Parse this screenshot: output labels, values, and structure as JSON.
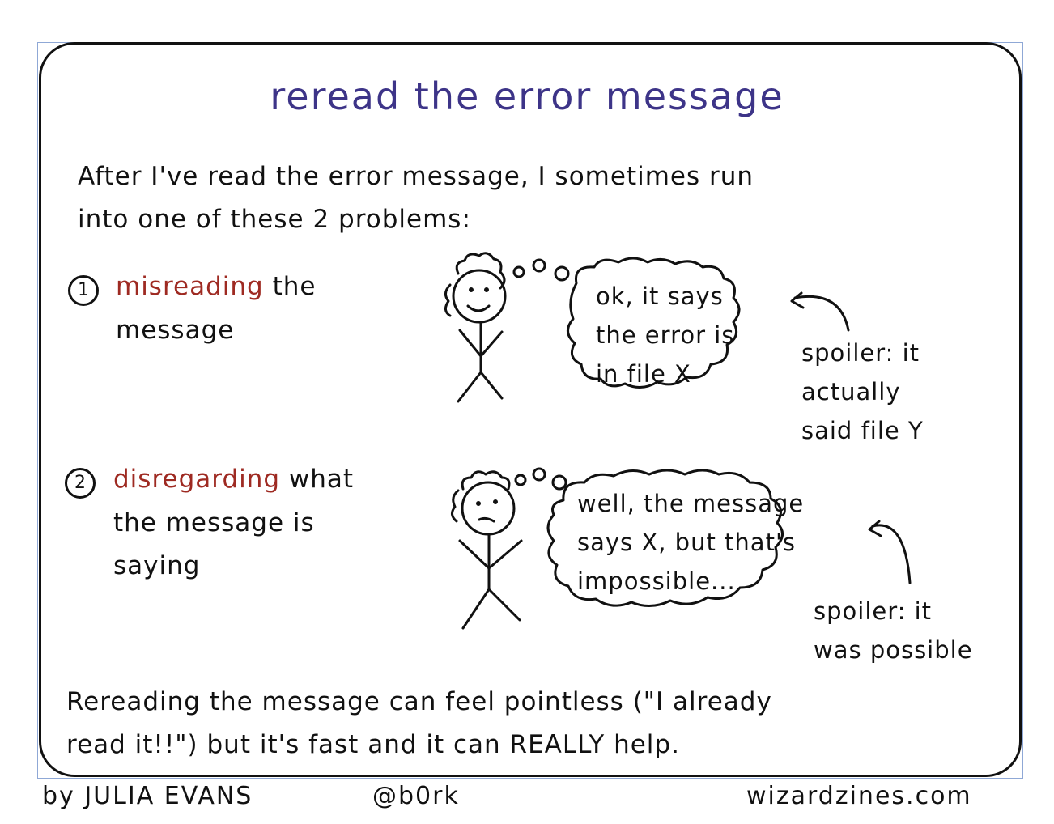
{
  "title": "reread the error message",
  "intro": [
    "After I've read the error message, I sometimes run",
    "into one of these 2 problems:"
  ],
  "problem1": {
    "number": "1",
    "highlight": "misreading",
    "rest": " the",
    "line2": "message",
    "thought": [
      "ok, it says",
      "the error is",
      "in file X"
    ],
    "spoiler": [
      "spoiler: it",
      "actually",
      "said file Y"
    ]
  },
  "problem2": {
    "number": "2",
    "highlight": "disregarding",
    "rest": " what",
    "line2": "the message is",
    "line3": "saying",
    "thought": [
      "well, the message",
      "says X, but that's",
      "impossible..."
    ],
    "spoiler": [
      "spoiler: it",
      "was possible"
    ]
  },
  "conclusion": [
    "Rereading the message can feel pointless (\"I already",
    "read it!!\") but it's fast and it can REALLY help."
  ],
  "footer": {
    "author": "by JULIA EVANS",
    "handle": "@b0rk",
    "site": "wizardzines.com"
  },
  "colors": {
    "title": "#3d3488",
    "highlight": "#9e2a22",
    "ink": "#111111"
  }
}
